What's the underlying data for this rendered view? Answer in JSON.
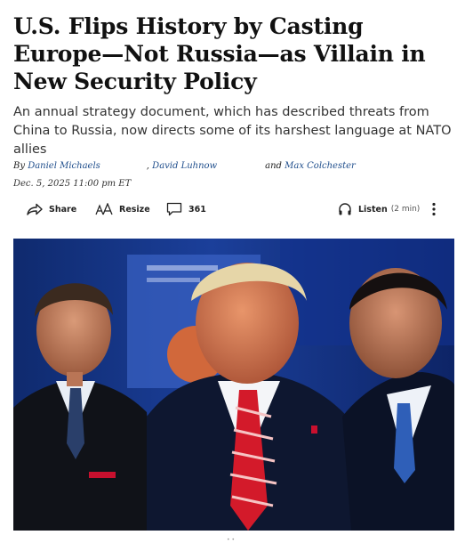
{
  "article": {
    "headline": "U.S. Flips History by Casting Europe—Not Russia—as Villain in New Security Policy",
    "dek": "An annual strategy document, which has described threats from China to Russia, now directs some of its harshest language at NATO allies",
    "byline": {
      "prefix": "By",
      "authors": [
        "Daniel Michaels",
        "David Luhnow",
        "Max Colchester"
      ],
      "separator": ",",
      "conjunction": "and"
    },
    "dateline": "Dec. 5, 2025 11:00 pm ET"
  },
  "toolbar": {
    "share_label": "Share",
    "resize_label": "Resize",
    "comment_count": "361",
    "listen_label": "Listen",
    "listen_duration": "(2 min)",
    "icons": [
      "share-icon",
      "resize-icon",
      "comment-icon",
      "headphones-icon",
      "more-vertical-icon"
    ]
  },
  "photo": {
    "description": "news-photo"
  },
  "colors": {
    "author_link": "#1f4e8c",
    "text": "#111111",
    "dek_text": "#333333"
  }
}
